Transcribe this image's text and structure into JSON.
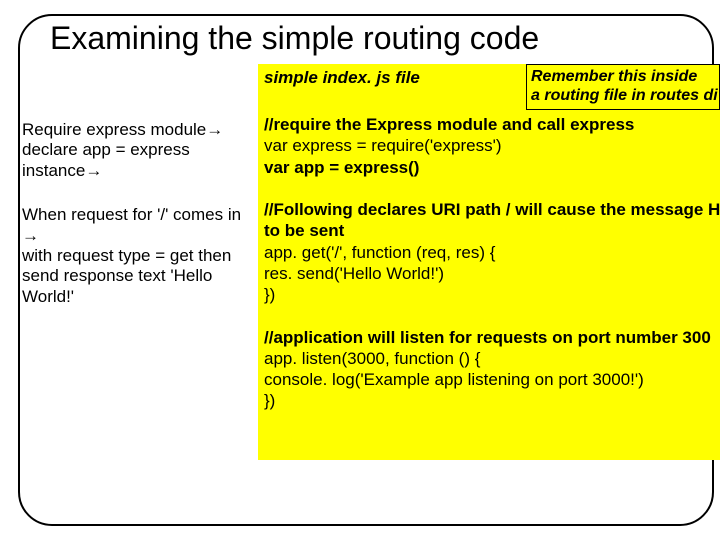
{
  "title": "Examining the simple routing code",
  "left": {
    "block1": "Require express module→ declare app = express instance→",
    "block2": "When request for '/' comes in →\nwith request type = get then send response text  'Hello World!'"
  },
  "code": {
    "header": "simple index. js file",
    "lines": [
      {
        "t": "//require the Express module and call express",
        "b": true
      },
      {
        "t": "var express = require('express')",
        "b": false
      },
      {
        "t": "var app = express()",
        "b": true
      },
      {
        "t": "",
        "b": false
      },
      {
        "t": "//Following declares URI path / will cause the message Hell",
        "b": true
      },
      {
        "t": "to be sent",
        "b": true
      },
      {
        "t": "app. get('/', function (req, res) {",
        "b": false
      },
      {
        "t": "res. send('Hello World!')",
        "b": false
      },
      {
        "t": "})",
        "b": false
      },
      {
        "t": "",
        "b": false
      },
      {
        "t": "//application will listen for requests on port number 300",
        "b": true
      },
      {
        "t": "app. listen(3000, function () {",
        "b": false
      },
      {
        "t": "console. log('Example app listening on port 3000!')",
        "b": false
      },
      {
        "t": "})",
        "b": false
      }
    ]
  },
  "remember": {
    "line1": "Remember this inside",
    "line2": "a routing file in routes di"
  }
}
